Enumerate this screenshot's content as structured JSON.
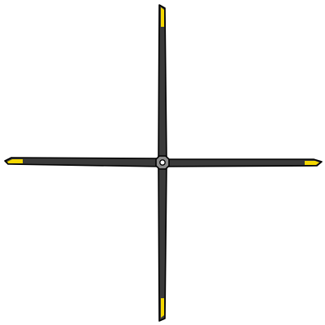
{
  "sprite": {
    "object": "helicopter-rotor",
    "blade_count": 4,
    "colors": {
      "background": "#ffffff",
      "outline": "#000000",
      "blade": "#3a3a3a",
      "blade_highlight": "#5a5a5a",
      "tip": "#f5d800",
      "hub": "#8c8c8c",
      "hub_center": "#ffffff"
    }
  }
}
